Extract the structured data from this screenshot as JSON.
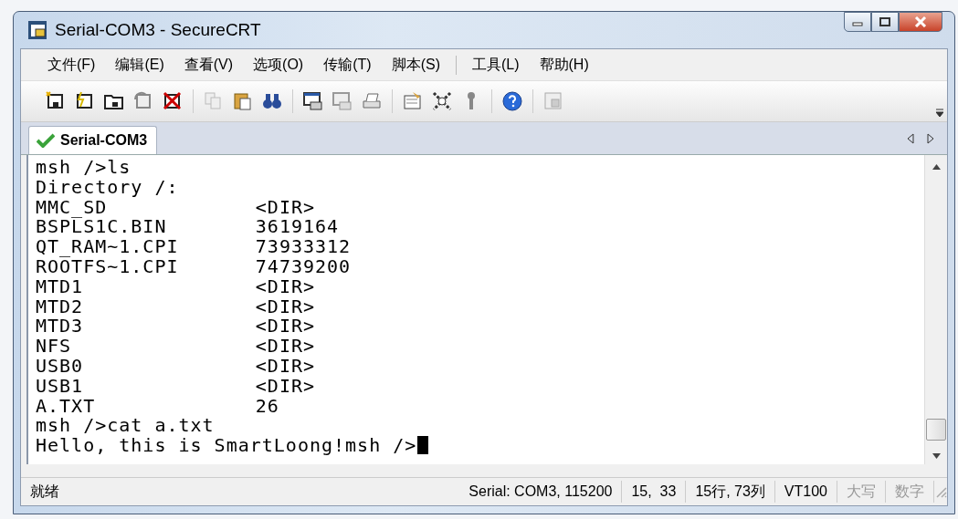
{
  "window": {
    "title": "Serial-COM3 - SecureCRT"
  },
  "menu": [
    {
      "label": "文件(F)",
      "separator_before": false
    },
    {
      "label": "编辑(E)",
      "separator_before": false
    },
    {
      "label": "查看(V)",
      "separator_before": false
    },
    {
      "label": "选项(O)",
      "separator_before": false
    },
    {
      "label": "传输(T)",
      "separator_before": false
    },
    {
      "label": "脚本(S)",
      "separator_before": false
    },
    {
      "label": "工具(L)",
      "separator_before": true
    },
    {
      "label": "帮助(H)",
      "separator_before": false
    }
  ],
  "tabs": [
    {
      "label": "Serial-COM3",
      "selected": true,
      "connected": true
    }
  ],
  "terminal": {
    "cursor_visible": true,
    "lines": [
      {
        "kind": "text",
        "text": "msh />ls"
      },
      {
        "kind": "text",
        "text": "Directory /:"
      },
      {
        "kind": "entry",
        "name": "MMC_SD",
        "value": "<DIR>"
      },
      {
        "kind": "entry",
        "name": "BSPLS1C.BIN",
        "value": "3619164"
      },
      {
        "kind": "entry",
        "name": "QT_RAM~1.CPI",
        "value": "73933312"
      },
      {
        "kind": "entry",
        "name": "ROOTFS~1.CPI",
        "value": "74739200"
      },
      {
        "kind": "entry",
        "name": "MTD1",
        "value": "<DIR>"
      },
      {
        "kind": "entry",
        "name": "MTD2",
        "value": "<DIR>"
      },
      {
        "kind": "entry",
        "name": "MTD3",
        "value": "<DIR>"
      },
      {
        "kind": "entry",
        "name": "NFS",
        "value": "<DIR>"
      },
      {
        "kind": "entry",
        "name": "USB0",
        "value": "<DIR>"
      },
      {
        "kind": "entry",
        "name": "USB1",
        "value": "<DIR>"
      },
      {
        "kind": "entry",
        "name": "A.TXT",
        "value": "26"
      },
      {
        "kind": "text",
        "text": "msh />cat a.txt"
      },
      {
        "kind": "text",
        "text": "Hello, this is SmartLoong!msh />"
      }
    ]
  },
  "status_bar": [
    {
      "text": "就绪",
      "disabled": false
    },
    {
      "text": "Serial: COM3, 115200",
      "disabled": false
    },
    {
      "text": "15,  33",
      "disabled": false
    },
    {
      "text": "15行, 73列",
      "disabled": false
    },
    {
      "text": "VT100",
      "disabled": false
    },
    {
      "text": "大写",
      "disabled": true
    },
    {
      "text": "数字",
      "disabled": true
    }
  ]
}
